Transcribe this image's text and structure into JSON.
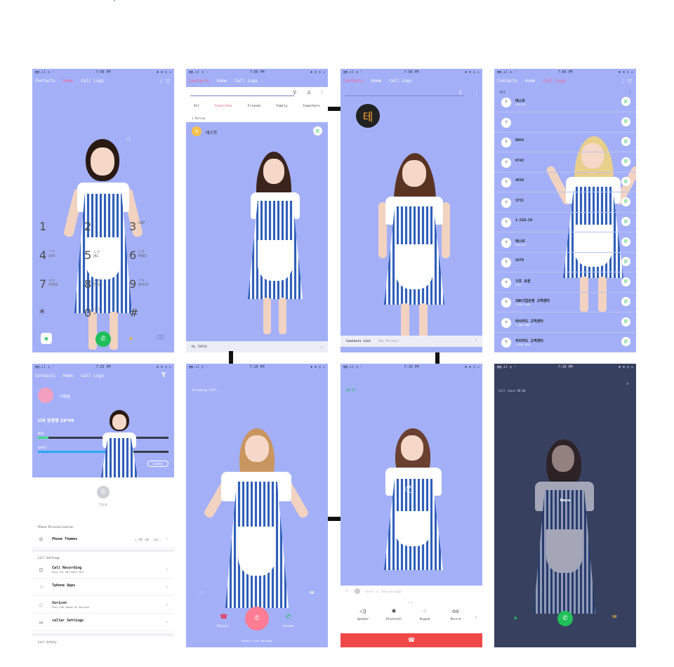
{
  "top_dot": "·",
  "status": {
    "signal": "▤▤.ıl ◎ ♡",
    "time": "7:08 PM",
    "time2": "7:25 PM",
    "time3": "7:10 PM",
    "batt": "✱ ⊕ ◎ ▭"
  },
  "tabs": {
    "contacts": "Contacts",
    "home": "Home",
    "call_logs": "Call Logs"
  },
  "dialer": {
    "keys": [
      {
        "n": "1",
        "l": ""
      },
      {
        "n": "2",
        "l": ""
      },
      {
        "n": "3",
        "l": "DEF"
      },
      {
        "n": "4",
        "l": "ㄱㅋ\nGHI"
      },
      {
        "n": "5",
        "l": "ㄴㄹ\nJKL"
      },
      {
        "n": "6",
        "l": "ㄷㅌ\nMNO"
      },
      {
        "n": "7",
        "l": "ㅂㅍ\nPQRS"
      },
      {
        "n": "8",
        "l": "ㅅㅎ\nTUV"
      },
      {
        "n": "9",
        "l": "ㅈㅊ\nWXYZ"
      },
      {
        "n": "*",
        "l": ""
      },
      {
        "n": "0",
        "l": "ㅇㅁ\n+"
      },
      {
        "n": "#",
        "l": ""
      }
    ]
  },
  "contacts": {
    "filters": [
      "All",
      "Favorites",
      "Friends",
      "Family",
      "Coworkers"
    ],
    "active_filter": "Favorites",
    "section": "1 Person",
    "favorite_name": "테스트",
    "group_label": "My TOP10",
    "avatar_letter": "테",
    "list_label": "Contacts List",
    "list_count": "184 Persons"
  },
  "calllogs": {
    "filter": "All",
    "rows": [
      {
        "name": "테스트",
        "sub": "010-423"
      },
      {
        "name": "",
        "sub": ""
      },
      {
        "name": "8654",
        "sub": ""
      },
      {
        "name": "6742",
        "sub": ""
      },
      {
        "name": "4634",
        "sub": ""
      },
      {
        "name": "3721",
        "sub": ""
      },
      {
        "name": "1-518-28",
        "sub": ""
      },
      {
        "name": "테스트",
        "sub": "010-423"
      },
      {
        "name": "5679",
        "sub": ""
      },
      {
        "name": "구조 요청",
        "sub": "1234"
      },
      {
        "name": "IBK기업은행 고객센터",
        "sub": "1-566-2566"
      },
      {
        "name": "비씨카드 고객센터",
        "sub": "1-588-4000"
      },
      {
        "name": "우리카드 고객센터",
        "sub": "1-588-9955"
      }
    ]
  },
  "home": {
    "user": "구혜원",
    "plan": "LTE 망종탱 29*99",
    "voice": "통화",
    "data": "데이터",
    "update": "Update",
    "tphone_label": "T전화",
    "personalization": "Phone Personalization",
    "themes": "Phone Themes",
    "themes_value": "1 건만 1회 · 고고..",
    "call_settings": "Call Settings",
    "items": [
      {
        "t": "Call Recording",
        "s": "Only for SKT Bare Call",
        "icon": "mic-icon"
      },
      {
        "t": "Tphone Apps",
        "s": "",
        "icon": "apps-icon"
      },
      {
        "t": "Soricon",
        "s": "Play the sound of Soricon",
        "icon": "sound-icon"
      },
      {
        "t": "callar Settings",
        "s": "",
        "icon": "card-icon"
      }
    ],
    "call_safety": "Call Safety"
  },
  "incoming": {
    "label": "Incoming Call...",
    "reject": "Reject",
    "answer": "Answer",
    "hint": "Reject with message"
  },
  "incall": {
    "number": "00:07",
    "msg_placeholder": "Enter or Show message",
    "controls": [
      {
        "label": "Speaker",
        "icon": "speaker-icon",
        "glyph": "◁)"
      },
      {
        "label": "Bluetooth",
        "icon": "bluetooth-icon",
        "glyph": "✱"
      },
      {
        "label": "Keypad",
        "icon": "keypad-icon",
        "glyph": "⁘"
      },
      {
        "label": "Record",
        "icon": "record-icon",
        "glyph": "ᴏᴏ"
      }
    ]
  },
  "dark": {
    "label": "Call leave 00:00",
    "name": "Nana"
  },
  "colors": {
    "bg": "#a3b0f8",
    "accent": "#ff5a8a",
    "green": "#1fbf5a",
    "red": "#f04848",
    "dark": "#384060"
  }
}
